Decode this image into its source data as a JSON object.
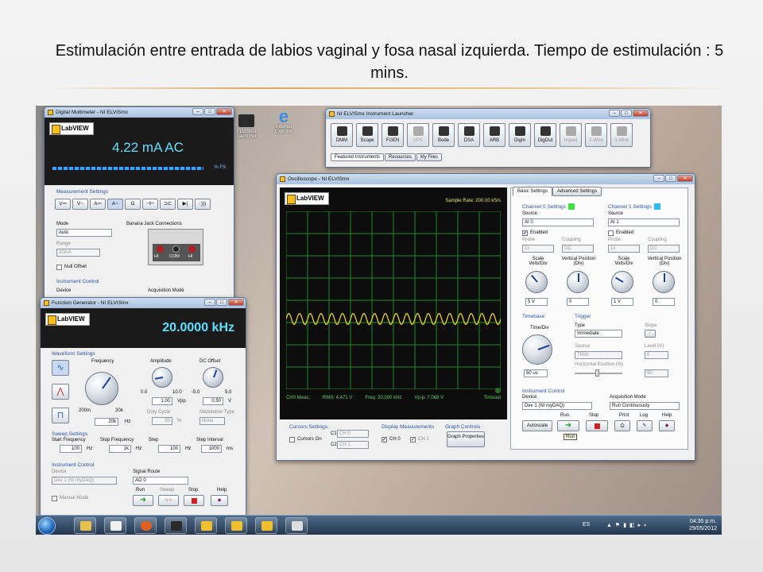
{
  "slide": {
    "title": "Estimulación entre entrada de labios vaginal y fosa nasal izquierda. Tiempo de estimulación : 5 mins."
  },
  "desktop": {
    "icons": [
      {
        "label": "ELVISmx Launcher",
        "icon": "elvis-icon"
      },
      {
        "label": "Internet Explorer",
        "icon": "ie-icon"
      }
    ]
  },
  "dmm": {
    "title": "Digital Multimeter - NI ELVISmx",
    "brand": "LabVIEW",
    "reading": "4.22 mA AC",
    "scale_label": "% FS",
    "measurement_settings": "Measurement Settings",
    "mode_label": "Mode",
    "mode_value": "Auto",
    "range_label": "Range",
    "range_value": "20mA",
    "null_offset": "Null Offset",
    "banana_label": "Banana Jack Connections",
    "jacks": [
      "HI",
      "COM",
      "HI"
    ],
    "instrument_control": "Instrument Control",
    "device_label": "Device",
    "acq_label": "Acquisition Mode",
    "buttons": [
      "V⎓",
      "V~",
      "A⎓",
      "A~",
      "Ω",
      "⊣⊢",
      "⊐⊏",
      "▶|",
      "·)))"
    ]
  },
  "launcher": {
    "title": "NI ELVISmx Instrument Launcher",
    "tools": [
      "DMM",
      "Scope",
      "FGEN",
      "VPS",
      "Bode",
      "DSA",
      "ARB",
      "DigIn",
      "DigOut",
      "Imped",
      "2-Wire",
      "3-Wire"
    ],
    "tabs": [
      "Featured Instruments",
      "Resources",
      "My Files"
    ]
  },
  "fgen": {
    "title": "Function Generator - NI ELVISmx",
    "brand": "LabVIEW",
    "frequency_display": "20.0000 kHz",
    "waveform_settings": "Waveform Settings",
    "frequency_label": "Frequency",
    "amplitude_label": "Amplitude",
    "dc_offset_label": "DC Offset",
    "amp_min": "0.0",
    "amp_max": "10.0",
    "dc_min": "-5.0",
    "dc_max": "5.0",
    "freq_min": "200m",
    "freq_max": "20k",
    "freq_value": "20k",
    "freq_unit": "Hz",
    "amp_value": "1.00",
    "amp_unit": "Vpp",
    "dc_value": "0.50",
    "dc_unit": "V",
    "duty_label": "Duty Cycle",
    "duty_value": "50",
    "duty_unit": "%",
    "mod_label": "Modulation Type",
    "mod_value": "None",
    "sweep_settings": "Sweep Settings",
    "start_freq_label": "Start Frequency",
    "start_freq_value": "100",
    "stop_freq_label": "Stop Frequency",
    "stop_freq_value": "1k",
    "step_label": "Step",
    "step_value": "100",
    "step_int_label": "Step Interval",
    "step_int_value": "1000",
    "step_int_unit": "ms",
    "hz": "Hz",
    "instrument_control": "Instrument Control",
    "device_label": "Device",
    "device_value": "Dev 1 (NI myDAQ)",
    "signal_route_label": "Signal Route",
    "signal_route_value": "AO 0",
    "manual_mode": "Manual Mode",
    "run": "Run",
    "sweep": "Sweep",
    "stop": "Stop",
    "help": "Help"
  },
  "scope": {
    "title": "Oscilloscope - NI ELVISmx",
    "brand": "LabVIEW",
    "sample_rate": "Sample Rate:  200.00 kS/s",
    "meas_label": "CH0 Meas:",
    "rms": "RMS:  4.471 V",
    "freq": "Freq:  20.000 kHz",
    "vpp": "Vp-p:  7.068 V",
    "timeout": "Timeout",
    "wave_color": "#e6d020",
    "grid_color": "#1f8a2a",
    "cursors_settings": "Cursors Settings",
    "cursors_on": "Cursors On",
    "c1": "C1",
    "c2": "C2",
    "c1_value": "CH 0",
    "c2_value": "CH 1",
    "display_measurements": "Display Measurements",
    "ch0": "CH 0",
    "ch1": "CH 1",
    "graph_controls": "Graph Controls",
    "graph_properties": "Graph Properties",
    "tabs": [
      "Basic Settings",
      "Advanced Settings"
    ],
    "ch0_settings": "Channel 0 Settings",
    "ch1_settings": "Channel 1 Settings",
    "source_label": "Source",
    "ch0_source": "AI 0",
    "ch1_source": "AI 1",
    "enabled": "Enabled",
    "probe_label": "Probe",
    "coupling_label": "Coupling",
    "probe_value": "1x",
    "coupling_value": "DC",
    "scale_label": "Scale Volts/Div",
    "vpos_label": "Vertical Position (Div)",
    "ch0_scale": "5 V",
    "ch0_pos": "0",
    "ch1_scale": "1 V",
    "ch1_pos": "0",
    "timebase": "Timebase",
    "time_div": "Time/Div",
    "time_value": "50 us",
    "trigger": "Trigger",
    "type_label": "Type",
    "type_value": "Immediate",
    "slope_label": "Slope",
    "trig_source_label": "Source",
    "trig_source_value": "TRIG",
    "level_label": "Level (V)",
    "level_value": "0",
    "hpos_label": "Horizontal Position (%)",
    "hpos_value": "50",
    "instrument_control": "Instrument Control",
    "device_label": "Device",
    "device_value": "Dev 1 (NI myDAQ)",
    "acq_label": "Acquisition Mode",
    "acq_value": "Run Continuously",
    "autoscale": "Autoscale",
    "run": "Run",
    "stop": "Stop",
    "print": "Print",
    "log": "Log",
    "help": "Help",
    "tooltip": "Run"
  },
  "taskbar": {
    "lang": "ES",
    "time": "04:35 p.m.",
    "date": "29/05/2012"
  }
}
